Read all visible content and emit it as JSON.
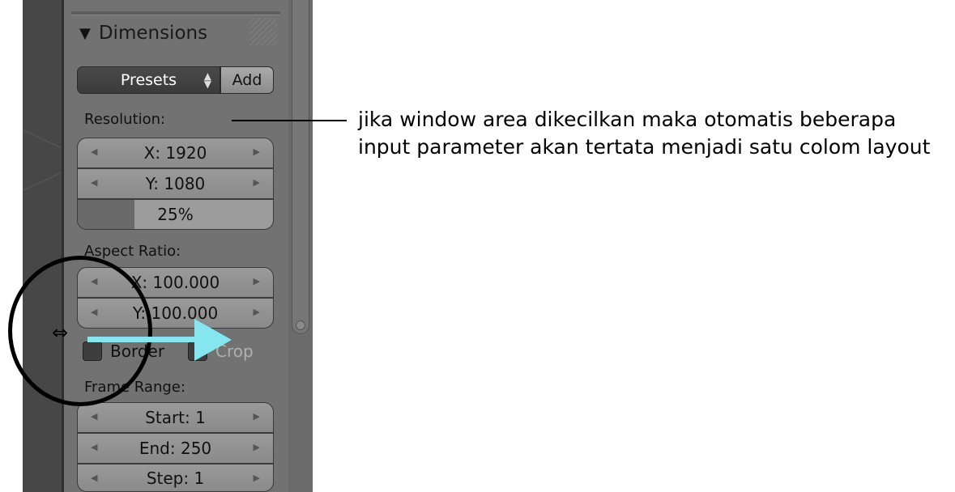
{
  "panel": {
    "title": "Dimensions",
    "presets_label": "Presets",
    "add_label": "Add",
    "resolution_label": "Resolution:",
    "res_x": "X: 1920",
    "res_y": "Y: 1080",
    "res_percent": "25%",
    "res_percent_value": 25,
    "aspect_label": "Aspect Ratio:",
    "aspect_x": "X: 100.000",
    "aspect_y": "Y: 100.000",
    "border_label": "Border",
    "crop_label": "Crop",
    "frame_range_label": "Frame Range:",
    "start": "Start: 1",
    "end": "End: 250",
    "step": "Step: 1"
  },
  "annotation": {
    "line1": "jika  window area dikecilkan maka otomatis beberapa",
    "line2": "input parameter akan tertata menjadi satu colom layout"
  },
  "colors": {
    "panel_bg": "#727272",
    "highlight_circle": "#000000",
    "arrow": "#86e6f0"
  },
  "icons": {
    "collapse": "triangle-down-icon",
    "presets_spinner": "updown-icon",
    "field_arrows": "chevron-left-right-icon",
    "cursor": "horizontal-resize-cursor-icon"
  }
}
